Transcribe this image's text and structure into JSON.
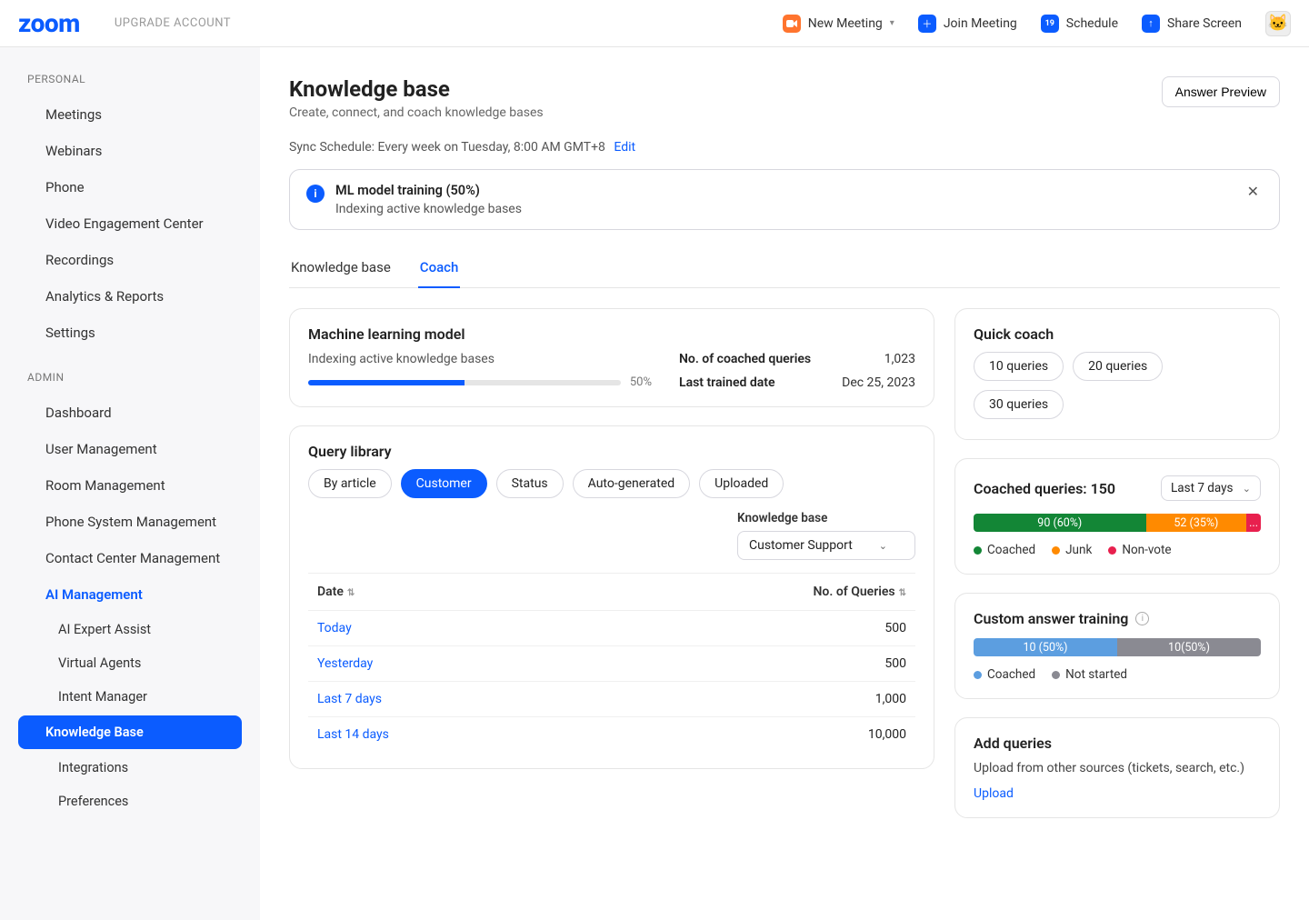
{
  "topbar": {
    "logo": "zoom",
    "upgrade": "UPGRADE ACCOUNT",
    "actions": {
      "new_meeting": "New Meeting",
      "join_meeting": "Join Meeting",
      "schedule": "Schedule",
      "calendar_day": "19",
      "share_screen": "Share Screen"
    }
  },
  "sidebar": {
    "section_personal": "PERSONAL",
    "section_admin": "ADMIN",
    "personal": [
      "Meetings",
      "Webinars",
      "Phone",
      "Video Engagement Center",
      "Recordings",
      "Analytics & Reports",
      "Settings"
    ],
    "admin": [
      "Dashboard",
      "User Management",
      "Room Management",
      "Phone System Management",
      "Contact Center Management",
      "AI Management"
    ],
    "ai_sub": [
      "AI Expert Assist",
      "Virtual Agents",
      "Intent Manager",
      "Knowledge Base",
      "Integrations",
      "Preferences"
    ]
  },
  "page": {
    "title": "Knowledge base",
    "subtitle": "Create, connect, and coach knowledge bases",
    "answer_preview": "Answer Preview",
    "sync_label": "Sync Schedule: Every week on Tuesday, 8:00 AM GMT+8",
    "sync_edit": "Edit"
  },
  "banner": {
    "title": "ML model training (50%)",
    "desc": "Indexing active knowledge bases"
  },
  "tabs": {
    "kb": "Knowledge base",
    "coach": "Coach"
  },
  "ml_card": {
    "title": "Machine learning model",
    "status": "Indexing active knowledge bases",
    "pct_label": "50%",
    "pct_value": 50,
    "coached_label": "No. of coached queries",
    "coached_value": "1,023",
    "trained_label": "Last trained date",
    "trained_value": "Dec 25, 2023"
  },
  "query_lib": {
    "title": "Query library",
    "filters": [
      "By article",
      "Customer",
      "Status",
      "Auto-generated",
      "Uploaded"
    ],
    "kb_label": "Knowledge base",
    "kb_value": "Customer Support",
    "col_date": "Date",
    "col_count": "No. of Queries",
    "rows": [
      {
        "label": "Today",
        "count": "500"
      },
      {
        "label": "Yesterday",
        "count": "500"
      },
      {
        "label": "Last 7 days",
        "count": "1,000"
      },
      {
        "label": "Last 14 days",
        "count": "10,000"
      }
    ]
  },
  "quick_coach": {
    "title": "Quick coach",
    "options": [
      "10 queries",
      "20 queries",
      "30 queries"
    ]
  },
  "coached": {
    "title": "Coached queries: 150",
    "range": "Last 7 days",
    "segments": [
      {
        "label": "90 (60%)",
        "pct": 60,
        "class": "green"
      },
      {
        "label": "52 (35%)",
        "pct": 35,
        "class": "orange"
      },
      {
        "label": "...",
        "pct": 5,
        "class": "red"
      }
    ],
    "legend": [
      {
        "label": "Coached",
        "color": "#138636"
      },
      {
        "label": "Junk",
        "color": "#ff8a00"
      },
      {
        "label": "Non-vote",
        "color": "#e8204e"
      }
    ]
  },
  "custom_training": {
    "title": "Custom answer training",
    "segments": [
      {
        "label": "10 (50%)",
        "pct": 50,
        "class": "blue"
      },
      {
        "label": "10(50%)",
        "pct": 50,
        "class": "grey"
      }
    ],
    "legend": [
      {
        "label": "Coached",
        "color": "#5c9ee0"
      },
      {
        "label": "Not started",
        "color": "#8a8a92"
      }
    ]
  },
  "add_queries": {
    "title": "Add queries",
    "desc": "Upload from other sources (tickets, search, etc.)",
    "link": "Upload"
  }
}
